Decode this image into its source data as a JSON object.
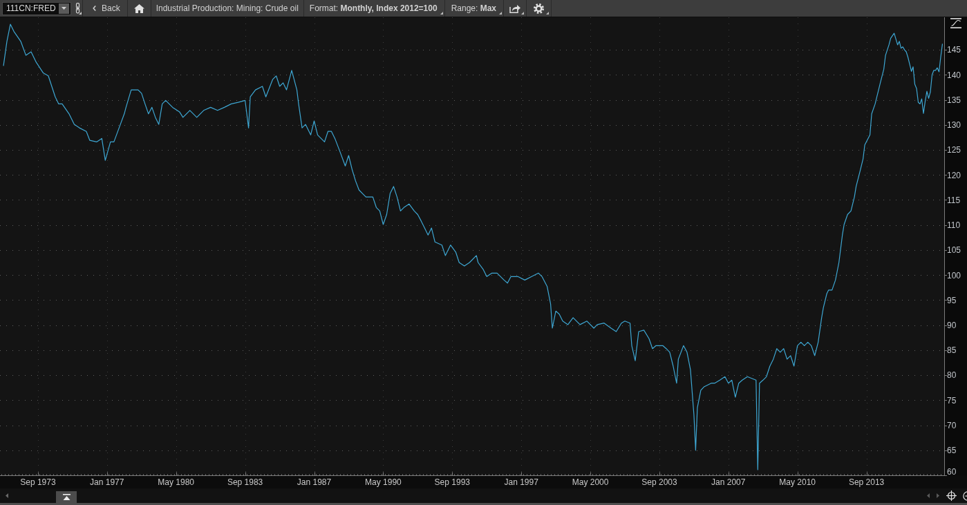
{
  "toolbar": {
    "symbol": "111CN:FRED",
    "back_label": "Back",
    "title": "Industrial Production: Mining: Crude oil",
    "format": "Format: **Monthly, Index 2012=100**",
    "range": "Range: **Max**"
  },
  "chart": {
    "chart_data": {
      "type": "line",
      "grid": true,
      "xlim": [
        "1971-11",
        "2017-06"
      ],
      "ylim": [
        60,
        151.5
      ],
      "xticks": [
        {
          "value": "1973-09",
          "label": "Sep 1973"
        },
        {
          "value": "1977-01",
          "label": "Jan 1977"
        },
        {
          "value": "1980-05",
          "label": "May 1980"
        },
        {
          "value": "1983-09",
          "label": "Sep 1983"
        },
        {
          "value": "1987-01",
          "label": "Jan 1987"
        },
        {
          "value": "1990-05",
          "label": "May 1990"
        },
        {
          "value": "1993-09",
          "label": "Sep 1993"
        },
        {
          "value": "1997-01",
          "label": "Jan 1997"
        },
        {
          "value": "2000-05",
          "label": "May 2000"
        },
        {
          "value": "2003-09",
          "label": "Sep 2003"
        },
        {
          "value": "2007-01",
          "label": "Jan 2007"
        },
        {
          "value": "2010-05",
          "label": "May 2010"
        },
        {
          "value": "2013-09",
          "label": "Sep 2013"
        }
      ],
      "yticks": [
        60,
        65,
        70,
        75,
        80,
        85,
        90,
        95,
        100,
        105,
        110,
        115,
        120,
        125,
        130,
        135,
        140,
        145
      ],
      "x": [
        "1972-01",
        "1972-03",
        "1972-05",
        "1972-07",
        "1972-11",
        "1973-02",
        "1973-05",
        "1973-08",
        "1973-12",
        "1974-03",
        "1974-07",
        "1974-09",
        "1974-11",
        "1975-03",
        "1975-06",
        "1975-09",
        "1976-01",
        "1976-03",
        "1976-07",
        "1976-10",
        "1976-12",
        "1977-03",
        "1977-05",
        "1977-08",
        "1977-11",
        "1977-12",
        "1978-03",
        "1978-07",
        "1978-09",
        "1978-11",
        "1979-01",
        "1979-03",
        "1979-05",
        "1979-07",
        "1979-09",
        "1979-11",
        "1980-03",
        "1980-07",
        "1980-09",
        "1981-01",
        "1981-05",
        "1981-09",
        "1982-01",
        "1982-05",
        "1982-09",
        "1983-01",
        "1983-05",
        "1983-09",
        "1983-11",
        "1983-12",
        "1984-03",
        "1984-07",
        "1984-09",
        "1985-01",
        "1985-03",
        "1985-05",
        "1985-07",
        "1985-09",
        "1985-12",
        "1986-03",
        "1986-04",
        "1986-06",
        "1986-08",
        "1986-11",
        "1987-01",
        "1987-03",
        "1987-05",
        "1987-07",
        "1987-09",
        "1987-11",
        "1988-01",
        "1988-04",
        "1988-07",
        "1988-09",
        "1988-11",
        "1989-01",
        "1989-03",
        "1989-05",
        "1989-07",
        "1989-11",
        "1990-01",
        "1990-03",
        "1990-05",
        "1990-07",
        "1990-09",
        "1990-11",
        "1991-01",
        "1991-03",
        "1991-05",
        "1991-08",
        "1991-11",
        "1992-01",
        "1992-03",
        "1992-05",
        "1992-07",
        "1992-09",
        "1992-11",
        "1993-03",
        "1993-05",
        "1993-08",
        "1993-11",
        "1994-01",
        "1994-04",
        "1994-07",
        "1994-11",
        "1994-12",
        "1995-03",
        "1995-05",
        "1995-08",
        "1995-11",
        "1996-03",
        "1996-05",
        "1996-07",
        "1996-11",
        "1997-03",
        "1997-07",
        "1997-11",
        "1998-01",
        "1998-04",
        "1998-06",
        "1998-07",
        "1998-09",
        "1998-11",
        "1999-01",
        "1999-04",
        "1999-07",
        "1999-11",
        "2000-03",
        "2000-07",
        "2000-09",
        "2001-01",
        "2001-05",
        "2001-08",
        "2001-11",
        "2002-01",
        "2002-04",
        "2002-05",
        "2002-07",
        "2002-09",
        "2002-12",
        "2003-03",
        "2003-05",
        "2003-07",
        "2003-11",
        "2004-01",
        "2004-03",
        "2004-05",
        "2004-07",
        "2004-08",
        "2004-11",
        "2005-01",
        "2005-03",
        "2005-05",
        "2005-06",
        "2005-07",
        "2005-09",
        "2005-11",
        "2006-03",
        "2006-05",
        "2006-08",
        "2006-11",
        "2007-01",
        "2007-03",
        "2007-05",
        "2007-07",
        "2007-09",
        "2007-12",
        "2008-03",
        "2008-05",
        "2008-06",
        "2008-07",
        "2008-09",
        "2008-11",
        "2009-01",
        "2009-03",
        "2009-05",
        "2009-07",
        "2009-09",
        "2009-11",
        "2010-01",
        "2010-03",
        "2010-05",
        "2010-07",
        "2010-09",
        "2010-11",
        "2011-01",
        "2011-03",
        "2011-05",
        "2011-07",
        "2011-08",
        "2011-10",
        "2011-11",
        "2012-01",
        "2012-03",
        "2012-05",
        "2012-07",
        "2012-08",
        "2012-10",
        "2012-12",
        "2013-02",
        "2013-03",
        "2013-05",
        "2013-07",
        "2013-08",
        "2013-11",
        "2013-12",
        "2014-02",
        "2014-03",
        "2014-05",
        "2014-07",
        "2014-08",
        "2014-10",
        "2014-11",
        "2015-01",
        "2015-03",
        "2015-04",
        "2015-05",
        "2015-06",
        "2015-07",
        "2015-08",
        "2015-09",
        "2015-10",
        "2015-11",
        "2015-12",
        "2016-01",
        "2016-02",
        "2016-03",
        "2016-04",
        "2016-05",
        "2016-06",
        "2016-07",
        "2016-08",
        "2016-09",
        "2016-10",
        "2016-11",
        "2016-12",
        "2017-01",
        "2017-02",
        "2017-03",
        "2017-04",
        "2017-05"
      ],
      "values": [
        141.8,
        146.7,
        150.1,
        148.7,
        146.7,
        143.9,
        144.6,
        142.5,
        140.4,
        139.8,
        135.6,
        134.2,
        134.2,
        132.2,
        130.1,
        129.4,
        128.7,
        126.9,
        126.6,
        127.3,
        122.9,
        126.6,
        126.6,
        129.4,
        132.2,
        133.5,
        137.0,
        137.0,
        136.3,
        134.2,
        132.2,
        133.5,
        131.5,
        130.1,
        134.2,
        134.9,
        133.5,
        132.6,
        131.5,
        132.9,
        131.5,
        132.9,
        133.5,
        132.9,
        133.5,
        134.2,
        134.5,
        134.9,
        129.4,
        135.6,
        137.0,
        137.7,
        135.6,
        139.1,
        139.8,
        137.7,
        138.4,
        137.0,
        140.9,
        137.0,
        134.2,
        129.4,
        130.1,
        128.0,
        130.8,
        128.0,
        127.3,
        126.6,
        128.7,
        128.7,
        127.3,
        124.6,
        121.8,
        123.9,
        121.1,
        118.8,
        117.0,
        116.3,
        115.6,
        115.6,
        113.5,
        112.8,
        110.1,
        112.1,
        116.3,
        117.7,
        115.6,
        112.8,
        113.5,
        114.2,
        112.8,
        112.1,
        110.8,
        109.4,
        108.0,
        109.4,
        106.6,
        106.0,
        103.9,
        106.0,
        104.6,
        102.5,
        101.8,
        102.5,
        103.9,
        102.5,
        101.1,
        99.7,
        100.4,
        100.4,
        99.0,
        98.4,
        99.7,
        99.7,
        99.0,
        99.7,
        100.4,
        99.7,
        97.7,
        94.2,
        89.4,
        92.8,
        92.2,
        90.8,
        90.1,
        91.5,
        90.1,
        90.8,
        89.4,
        90.1,
        90.4,
        89.4,
        88.7,
        90.4,
        90.8,
        90.4,
        85.9,
        82.9,
        88.7,
        89.0,
        87.3,
        85.3,
        85.9,
        85.9,
        85.3,
        84.6,
        81.8,
        78.4,
        83.2,
        85.9,
        84.6,
        81.1,
        72.1,
        65.0,
        73.5,
        77.0,
        77.7,
        78.4,
        78.4,
        79.0,
        79.7,
        78.4,
        79.0,
        75.6,
        78.4,
        79.0,
        79.7,
        79.3,
        79.0,
        61.1,
        78.4,
        79.0,
        79.7,
        81.8,
        83.2,
        85.3,
        84.6,
        85.3,
        83.2,
        83.9,
        81.8,
        85.9,
        86.6,
        85.9,
        86.6,
        85.9,
        83.9,
        86.6,
        91.5,
        93.5,
        96.3,
        97.0,
        97.0,
        99.0,
        102.5,
        108.0,
        110.1,
        112.1,
        112.8,
        115.6,
        117.7,
        120.4,
        123.2,
        126.0,
        128.0,
        132.2,
        134.2,
        135.6,
        138.4,
        141.1,
        143.9,
        146.0,
        147.3,
        148.3,
        146.0,
        146.7,
        145.3,
        145.6,
        145.0,
        144.6,
        143.5,
        142.1,
        140.7,
        141.6,
        138.1,
        137.3,
        134.5,
        134.2,
        135.2,
        132.3,
        134.7,
        136.7,
        135.3,
        136.6,
        140.0,
        140.9,
        140.9,
        141.4,
        140.6,
        143.6,
        146.2
      ]
    }
  }
}
